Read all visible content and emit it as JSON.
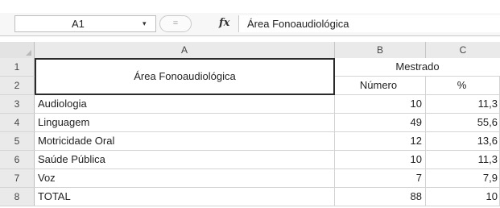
{
  "formula_bar": {
    "name_box": "A1",
    "dropdown_glyph": "▾",
    "round_button_glyph": "=",
    "fx_label": "fx",
    "content": "Área Fonoaudiológica"
  },
  "columns": [
    "A",
    "B",
    "C"
  ],
  "row_numbers": [
    "1",
    "2",
    "3",
    "4",
    "5",
    "6",
    "7",
    "8"
  ],
  "header": {
    "area_label": "Área Fonoaudiológica",
    "group_label": "Mestrado",
    "numero_label": "Número",
    "percent_label": "%"
  },
  "rows": [
    {
      "area": "Audiologia",
      "numero": "10",
      "pct": "11,3"
    },
    {
      "area": "Linguagem",
      "numero": "49",
      "pct": "55,6"
    },
    {
      "area": "Motricidade Oral",
      "numero": "12",
      "pct": "13,6"
    },
    {
      "area": "Saúde Pública",
      "numero": "10",
      "pct": "11,3"
    },
    {
      "area": "Voz",
      "numero": "7",
      "pct": "7,9"
    },
    {
      "area": "TOTAL",
      "numero": "88",
      "pct": "10"
    }
  ]
}
